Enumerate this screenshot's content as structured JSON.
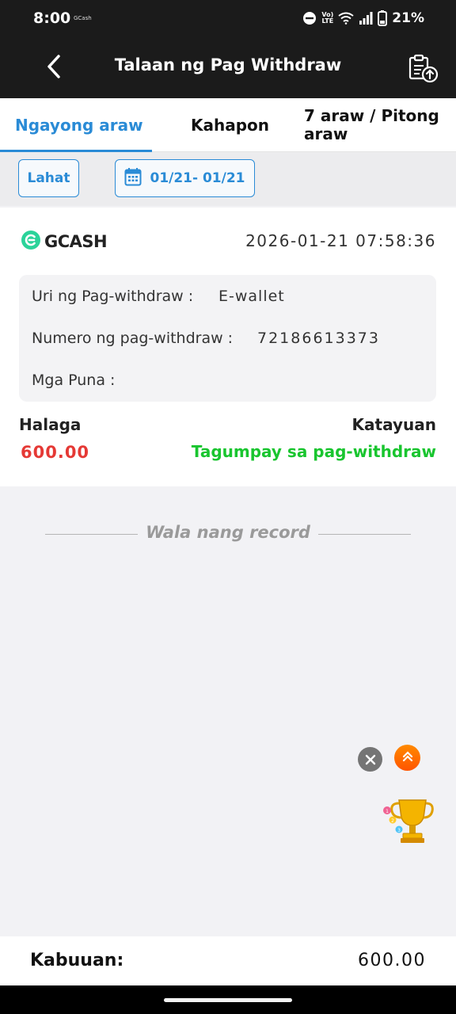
{
  "status_bar": {
    "time": "8:00",
    "app_notice": "GCash",
    "network": "VoLTE",
    "battery": "21%",
    "icons": [
      "do-not-disturb-icon",
      "volte-icon",
      "wifi-icon",
      "signal-icon",
      "battery-icon"
    ]
  },
  "header": {
    "title": "Talaan ng Pag Withdraw",
    "back_icon": "chevron-left-icon",
    "action_icon": "document-upload-icon"
  },
  "tabs": [
    {
      "label": "Ngayong araw",
      "active": true
    },
    {
      "label": "Kahapon",
      "active": false
    },
    {
      "label": "7 araw / Pitong araw",
      "active": false
    }
  ],
  "filters": {
    "all_label": "Lahat",
    "date_range": "01/21- 01/21",
    "date_icon": "calendar-icon"
  },
  "record": {
    "provider": "GCASH",
    "datetime": "2026-01-21 07:58:36",
    "type_label": "Uri ng Pag-withdraw :",
    "type_value": "E-wallet",
    "number_label": "Numero ng pag-withdraw :",
    "number_value": "72186613373",
    "remarks_label": "Mga Puna :",
    "remarks_value": "",
    "amount_label": "Halaga",
    "amount_value": "600.00",
    "status_label": "Katayuan",
    "status_value": "Tagumpay sa pag-withdraw"
  },
  "list_end_text": "Wala nang record",
  "floating": {
    "close_icon": "close-icon",
    "scroll_top_icon": "double-chevron-up-icon",
    "trophy_icon": "trophy-icon"
  },
  "footer": {
    "total_label": "Kabuuan:",
    "total_value": "600.00"
  },
  "colors": {
    "accent": "#2a8bd6",
    "amount": "#e53935",
    "success": "#19c52f",
    "header_bg": "#1b1b1b",
    "gcash_green": "#2bd39a"
  }
}
